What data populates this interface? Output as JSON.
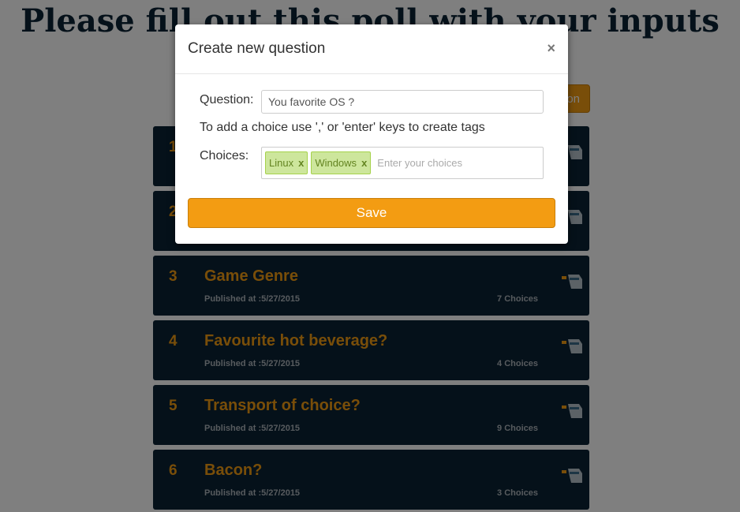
{
  "page": {
    "title": "Please fill out this poll with your inputs",
    "add_button_label": "on"
  },
  "polls": [
    {
      "number": "1",
      "title": "",
      "published": "",
      "choices": ""
    },
    {
      "number": "2",
      "title": "",
      "published": "",
      "choices": ""
    },
    {
      "number": "3",
      "title": "Game Genre",
      "published": "Published at :5/27/2015",
      "choices": "7 Choices"
    },
    {
      "number": "4",
      "title": "Favourite hot beverage?",
      "published": "Published at :5/27/2015",
      "choices": "4 Choices"
    },
    {
      "number": "5",
      "title": "Transport of choice?",
      "published": "Published at :5/27/2015",
      "choices": "9 Choices"
    },
    {
      "number": "6",
      "title": "Bacon?",
      "published": "Published at :5/27/2015",
      "choices": "3 Choices"
    }
  ],
  "modal": {
    "title": "Create new question",
    "close_symbol": "×",
    "question_label": "Question:",
    "question_value": "You favorite OS ?",
    "hint": "To add a choice use ',' or 'enter' keys to create tags",
    "choices_label": "Choices:",
    "tags": [
      {
        "label": "Linux",
        "remove": "x"
      },
      {
        "label": "Windows",
        "remove": "x"
      }
    ],
    "choices_placeholder": "Enter your choices",
    "save_label": "Save"
  },
  "colors": {
    "accent": "#f39c12",
    "card_bg": "#0b2234",
    "tag_bg": "#cde69c"
  },
  "icons": {
    "vote": "hand-vote-icon",
    "close": "close-icon"
  }
}
